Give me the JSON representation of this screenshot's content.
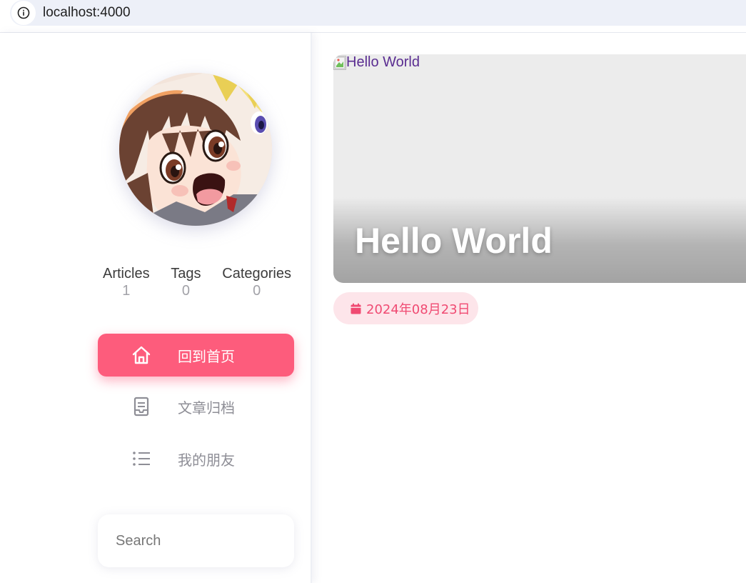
{
  "browser": {
    "url": "localhost:4000"
  },
  "profile": {
    "stats": [
      {
        "label": "Articles",
        "value": "1"
      },
      {
        "label": "Tags",
        "value": "0"
      },
      {
        "label": "Categories",
        "value": "0"
      }
    ]
  },
  "nav": {
    "items": [
      {
        "label": "回到首页",
        "icon": "home-icon",
        "active": true
      },
      {
        "label": "文章归档",
        "icon": "archive-icon",
        "active": false
      },
      {
        "label": "我的朋友",
        "icon": "list-icon",
        "active": false
      }
    ]
  },
  "search": {
    "placeholder": "Search"
  },
  "post": {
    "image_alt": "Hello World",
    "title": "Hello World",
    "date": "2024年08月23日"
  },
  "colors": {
    "accent": "#fd5c7c",
    "date_pill_bg": "#fde5ea",
    "date_text": "#f04a72"
  }
}
